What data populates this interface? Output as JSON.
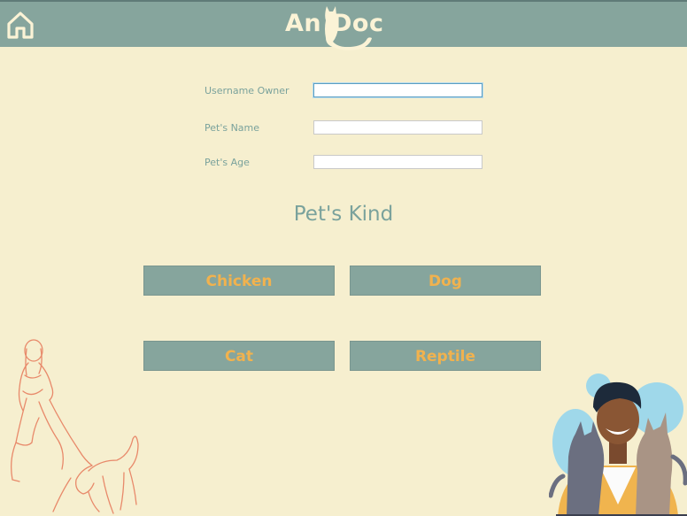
{
  "header": {
    "home_icon": "home-icon",
    "logo_part1": "An",
    "logo_part2": "Doc",
    "logo_icon": "cat-silhouette-icon"
  },
  "form": {
    "username_label": "Username Owner",
    "username_value": "",
    "pet_name_label": "Pet's Name",
    "pet_name_value": "",
    "pet_age_label": "Pet's Age",
    "pet_age_value": ""
  },
  "kind": {
    "title": "Pet's Kind",
    "options": [
      "Chicken",
      "Dog",
      "Cat",
      "Reptile"
    ]
  },
  "colors": {
    "background": "#f6efcf",
    "header": "#86a59d",
    "button": "#86a59d",
    "button_text": "#f1b24e",
    "label_text": "#7aa29c"
  }
}
